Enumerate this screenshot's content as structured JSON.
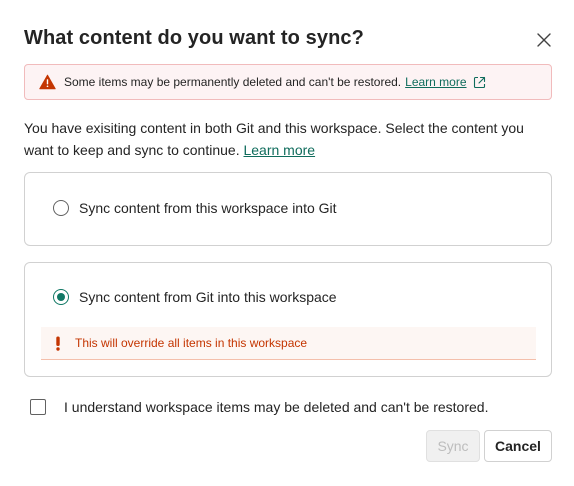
{
  "dialog": {
    "title": "What content do you want to sync?",
    "close_icon": "close-icon"
  },
  "warning": {
    "text": "Some items may be permanently deleted and can't be restored.",
    "link": "Learn more",
    "icon": "warning-icon",
    "link_icon": "external-link-icon"
  },
  "description": {
    "text": "You have exisiting content in both Git and this workspace. Select the content you want to keep and sync to continue.",
    "link": "Learn more"
  },
  "options": [
    {
      "label": "Sync content from this workspace into Git",
      "selected": false
    },
    {
      "label": "Sync content from Git into this workspace",
      "selected": true,
      "message": "This will override all items in this workspace",
      "message_icon": "exclamation-icon"
    }
  ],
  "acknowledge": {
    "label": "I understand workspace items may be deleted and can't be restored.",
    "checked": false
  },
  "buttons": {
    "sync": "Sync",
    "cancel": "Cancel"
  },
  "colors": {
    "accent": "#117865",
    "link": "#0f6c5c",
    "warning_icon": "#c43501",
    "warning_bg": "#fdf3f4",
    "override_text": "#c43501"
  }
}
